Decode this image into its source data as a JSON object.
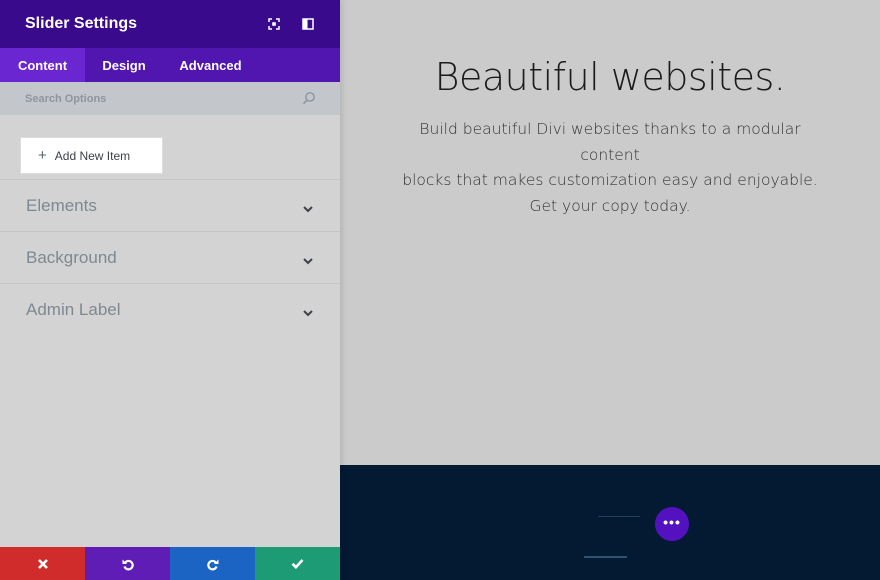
{
  "panel": {
    "title": "Slider Settings",
    "tabs": [
      {
        "label": "Content",
        "active": true
      },
      {
        "label": "Design",
        "active": false
      },
      {
        "label": "Advanced",
        "active": false
      }
    ],
    "search_placeholder": "Search Options",
    "add_item_label": "Add New Item",
    "groups": [
      {
        "label": "Elements"
      },
      {
        "label": "Background"
      },
      {
        "label": "Admin Label"
      }
    ],
    "footer": {
      "cancel_icon": "close-icon",
      "undo_icon": "undo-icon",
      "redo_icon": "redo-icon",
      "save_icon": "check-icon"
    }
  },
  "preview": {
    "heading": "Beautiful websites.",
    "body_lines": [
      "Build beautiful Divi websites thanks to a modular content",
      "blocks that makes customization easy and enjoyable.",
      "Get your copy today."
    ],
    "more_button_label": "•••"
  },
  "colors": {
    "header": "#3a0a8c",
    "tabs": "#5115b0",
    "active_tab": "#6a26d0",
    "cancel": "#d02c2c",
    "undo": "#5f1db5",
    "redo": "#1c64c4",
    "save": "#1d9b75",
    "dark_section": "#041a33",
    "dots_button": "#5411c0"
  }
}
